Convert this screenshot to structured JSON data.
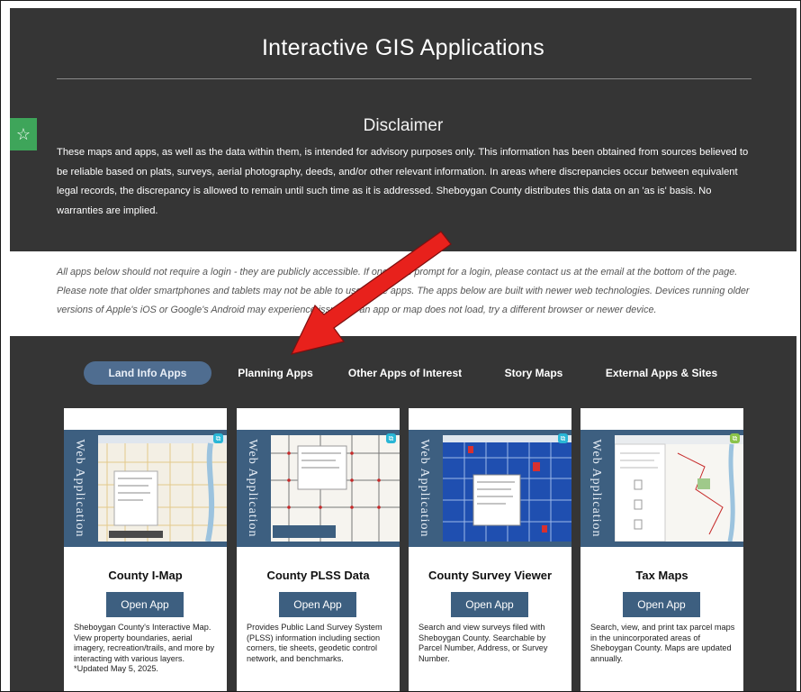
{
  "page": {
    "title": "Interactive GIS Applications",
    "favorite_icon": "star-icon",
    "disclaimer_title": "Disclaimer",
    "disclaimer_text": "These maps and apps, as well as the data within them, is intended for advisory purposes only. This information has been obtained from sources believed to be reliable based on plats, surveys, aerial photography, deeds, and/or other relevant information. In areas where discrepancies occur between equivalent legal records, the discrepancy is allowed to remain until such time as it is addressed. Sheboygan County distributes this data on an 'as is' basis. No warranties are implied.",
    "notice_text": "All apps below should not require a login - they are publicly accessible. If one does prompt for a login, please contact us at the email at the bottom of the page. Please note that older smartphones and tablets may not be able to use these apps. The apps below are built with newer web technologies. Devices running older versions of Apple's iOS or Google's Android may experience issues. If an app or map does not load, try a different browser or newer device."
  },
  "tabs": [
    {
      "label": "Land Info Apps",
      "active": true
    },
    {
      "label": "Planning Apps",
      "active": false
    },
    {
      "label": "Other Apps of Interest",
      "active": false
    },
    {
      "label": "Story Maps",
      "active": false
    },
    {
      "label": "External Apps & Sites",
      "active": false
    }
  ],
  "cards": [
    {
      "thumb_label": "Web Application",
      "title": "County I-Map",
      "button": "Open App",
      "description": "Sheboygan County's Interactive Map. View property boundaries, aerial imagery, recreation/trails, and more by interacting with various layers. *Updated May 5, 2025."
    },
    {
      "thumb_label": "Web Application",
      "title": "County PLSS Data",
      "button": "Open App",
      "description": "Provides Public Land Survey System (PLSS) information including section corners, tie sheets, geodetic control network, and benchmarks."
    },
    {
      "thumb_label": "Web Application",
      "title": "County Survey Viewer",
      "button": "Open App",
      "description": "Search and view surveys filed with Sheboygan County. Searchable by Parcel Number, Address, or Survey Number."
    },
    {
      "thumb_label": "Web Application",
      "title": "Tax Maps",
      "button": "Open App",
      "description": "Search, view, and print tax parcel maps in the unincorporated areas of Sheboygan County. Maps are updated annually."
    }
  ],
  "colors": {
    "dark_bg": "#353535",
    "accent": "#3d5f80",
    "active_tab": "#4f6d90",
    "favorite": "#3ea55a",
    "arrow": "#e8211c"
  }
}
